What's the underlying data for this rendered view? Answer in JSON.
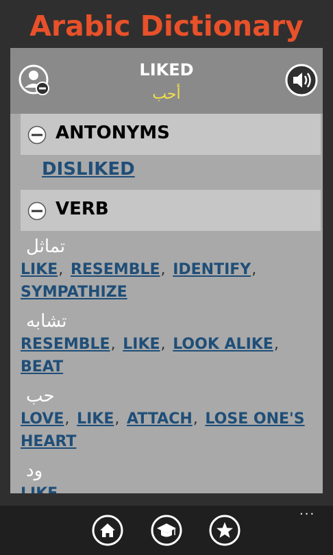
{
  "app": {
    "title": "Arabic Dictionary"
  },
  "entry": {
    "word": "LIKED",
    "translation": "أحب"
  },
  "antonyms": {
    "label": "ANTONYMS",
    "items": [
      "DISLIKED"
    ]
  },
  "verb": {
    "label": "VERB",
    "groups": [
      {
        "arabic": "تماثل",
        "words": [
          "LIKE",
          "RESEMBLE",
          "IDENTIFY",
          "SYMPATHIZE"
        ]
      },
      {
        "arabic": "تشابه",
        "words": [
          "RESEMBLE",
          "LIKE",
          "LOOK ALIKE",
          "BEAT"
        ]
      },
      {
        "arabic": "حب",
        "words": [
          "LOVE",
          "LIKE",
          "ATTACH",
          "LOSE ONE'S HEART"
        ]
      },
      {
        "arabic": "ود",
        "words": [
          "LIKE"
        ]
      }
    ]
  },
  "appbar": {
    "more": "···",
    "icons": [
      "home-icon",
      "graduation-cap-icon",
      "star-icon"
    ]
  },
  "colors": {
    "title": "#e8512a",
    "link": "#1f4e78",
    "translation": "#f4e14a"
  }
}
